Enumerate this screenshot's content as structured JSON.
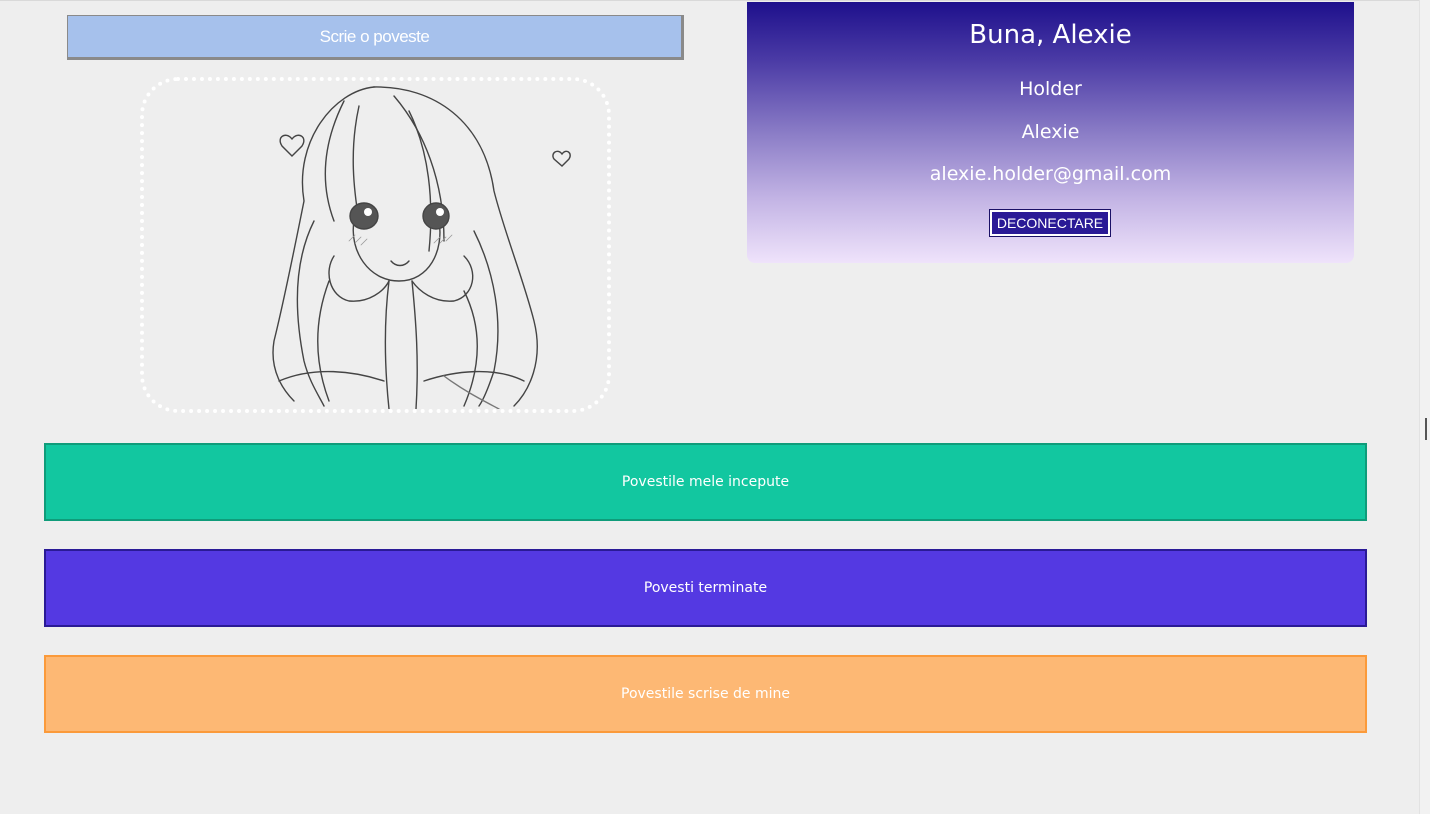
{
  "write_story_label": "Scrie o poveste",
  "profile": {
    "greeting": "Buna, Alexie",
    "last_name": "Holder",
    "first_name": "Alexie",
    "email": "alexie.holder@gmail.com",
    "logout_label": "DECONECTARE"
  },
  "story_buttons": {
    "started_label": "Povestile mele incepute",
    "finished_label": "Povesti terminate",
    "written_label": "Povestile scrise de mine"
  },
  "colors": {
    "page_background": "#eeeeee",
    "write_button": "#a6c1ec",
    "card_gradient_top": "#1e108c",
    "card_gradient_bottom": "#efe3fb",
    "logout_button": "#2a1a96",
    "started_button": "#12c7a0",
    "finished_button": "#5439e2",
    "written_button": "#fdb874"
  },
  "icons": {
    "avatar": "anime-girl-sketch-avatar",
    "hearts": "heart-icon"
  }
}
